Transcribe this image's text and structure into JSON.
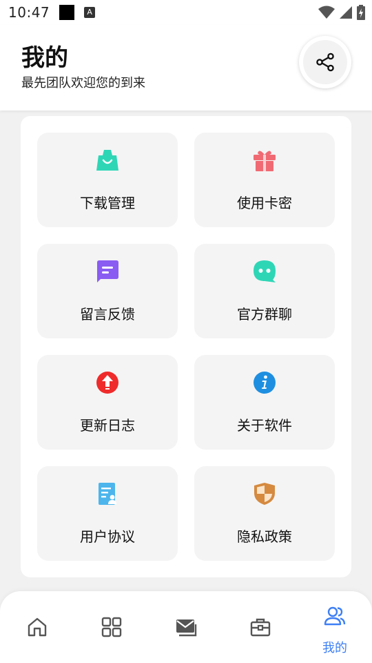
{
  "status_bar": {
    "time": "10:47",
    "notif_a": "A"
  },
  "header": {
    "title": "我的",
    "subtitle": "最先团队欢迎您的到来"
  },
  "menu": {
    "items": [
      {
        "label": "下载管理",
        "icon": "shopping-bag-icon",
        "color": "#2ed6b6"
      },
      {
        "label": "使用卡密",
        "icon": "gift-icon",
        "color": "#f06a73"
      },
      {
        "label": "留言反馈",
        "icon": "message-icon",
        "color": "#8a5cf2"
      },
      {
        "label": "官方群聊",
        "icon": "chat-bubble-icon",
        "color": "#2ed6b6"
      },
      {
        "label": "更新日志",
        "icon": "upload-arrow-icon",
        "color": "#ef2b2b"
      },
      {
        "label": "关于软件",
        "icon": "info-icon",
        "color": "#1e8fe0"
      },
      {
        "label": "用户协议",
        "icon": "document-icon",
        "color": "#4db5ec"
      },
      {
        "label": "隐私政策",
        "icon": "shield-icon",
        "color": "#d58a3f"
      }
    ]
  },
  "bottom_nav": {
    "active_color": "#3d7ff5",
    "items": [
      {
        "icon": "home-icon",
        "label": ""
      },
      {
        "icon": "grid-icon",
        "label": ""
      },
      {
        "icon": "mail-icon",
        "label": ""
      },
      {
        "icon": "toolbox-icon",
        "label": ""
      },
      {
        "icon": "users-icon",
        "label": "我的"
      }
    ]
  }
}
